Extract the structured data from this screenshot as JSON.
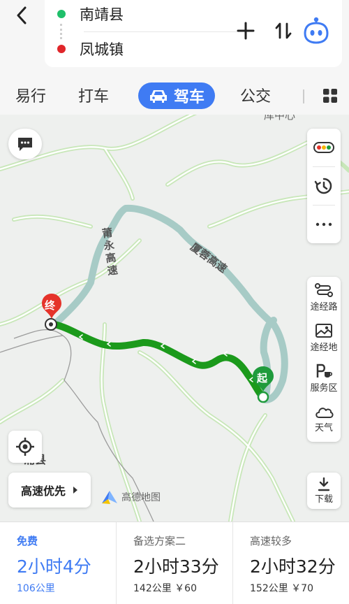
{
  "header": {
    "start": "南靖县",
    "end": "凤城镇",
    "start_color": "#1fbf6a",
    "end_color": "#e0262a"
  },
  "tabs": {
    "walk": "易行",
    "taxi": "打车",
    "drive": "驾车",
    "bus": "公交",
    "active_color": "#3f7bf3"
  },
  "map": {
    "labels": {
      "county": "浦县",
      "road_puyong": "莆永高速",
      "road_xiarong": "厦蓉高速",
      "top_cut": "库中心"
    },
    "markers": {
      "start": "起",
      "end": "终"
    },
    "colors": {
      "route_active": "#1b9a1b",
      "route_alt": "#a7cbc6",
      "start": "#1f9b3c",
      "end": "#e5332a"
    }
  },
  "controls": {
    "tools": [
      "途经路",
      "途经地",
      "服务区",
      "天气"
    ],
    "download": "下载",
    "preference": "高速优先",
    "logo": "高德地图"
  },
  "options": [
    {
      "tag": "免费",
      "time": "2小时4分",
      "meta": "106公里"
    },
    {
      "tag": "备选方案二",
      "time": "2小时33分",
      "meta": "142公里 ￥60"
    },
    {
      "tag": "高速较多",
      "time": "2小时32分",
      "meta": "152公里 ￥70"
    }
  ],
  "icons": {
    "back": "chevron-left-icon",
    "add": "plus-icon",
    "swap": "swap-icon",
    "avatar": "assistant-avatar-icon",
    "grid": "grid-icon",
    "message": "chat-icon",
    "traffic": "traffic-light-icon",
    "history": "history-icon",
    "more": "more-icon",
    "locate": "locate-icon"
  }
}
